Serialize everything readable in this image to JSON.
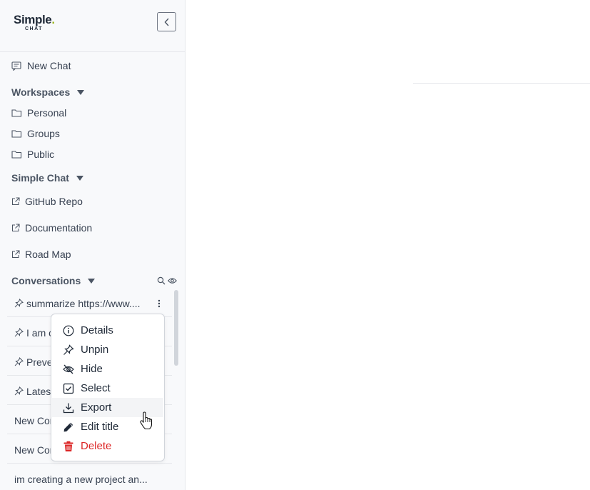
{
  "app": {
    "logo_text": "Simple",
    "logo_dot": ".",
    "logo_sub": "CHAT",
    "accent_color": "#9bb51f",
    "danger_color": "#dc2626"
  },
  "sidebar": {
    "new_chat_label": "New Chat",
    "workspaces": {
      "title": "Workspaces",
      "items": [
        {
          "label": "Personal",
          "icon": "folder-icon"
        },
        {
          "label": "Groups",
          "icon": "folder-icon"
        },
        {
          "label": "Public",
          "icon": "folder-icon"
        }
      ]
    },
    "simple_chat": {
      "title": "Simple Chat",
      "items": [
        {
          "label": "GitHub Repo",
          "icon": "external-link-icon"
        },
        {
          "label": "Documentation",
          "icon": "external-link-icon"
        },
        {
          "label": "Road Map",
          "icon": "external-link-icon"
        }
      ]
    },
    "conversations": {
      "title": "Conversations",
      "items": [
        {
          "label": "summarize https://www....",
          "pinned": true
        },
        {
          "label": "I am c",
          "pinned": true
        },
        {
          "label": "Preve",
          "pinned": true
        },
        {
          "label": "Latest",
          "pinned": true
        },
        {
          "label": "New Con",
          "pinned": false
        },
        {
          "label": "New Con",
          "pinned": false
        },
        {
          "label": "im creating a new project an...",
          "pinned": false
        }
      ]
    }
  },
  "context_menu": {
    "items": [
      {
        "label": "Details",
        "icon": "info-icon"
      },
      {
        "label": "Unpin",
        "icon": "pin-icon"
      },
      {
        "label": "Hide",
        "icon": "eye-off-icon"
      },
      {
        "label": "Select",
        "icon": "checkbox-icon"
      },
      {
        "label": "Export",
        "icon": "download-icon",
        "hovered": true
      },
      {
        "label": "Edit title",
        "icon": "pencil-icon"
      },
      {
        "label": "Delete",
        "icon": "trash-icon",
        "danger": true
      }
    ]
  }
}
